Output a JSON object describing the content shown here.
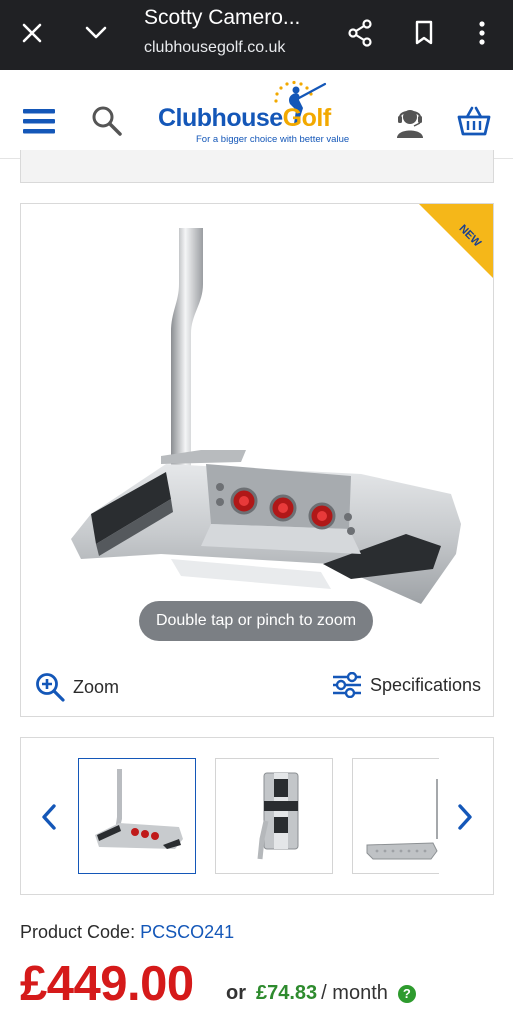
{
  "browser": {
    "title": "Scotty Camero...",
    "url": "clubhousegolf.co.uk",
    "icons": [
      "close-icon",
      "chevron-down-icon",
      "share-icon",
      "bookmark-icon",
      "more-vert-icon"
    ]
  },
  "site_header": {
    "logo_main": "Clubhouse",
    "logo_accent": "Golf",
    "tagline": "For a bigger choice with better value",
    "icons": [
      "menu-icon",
      "search-icon",
      "support-agent-icon",
      "basket-icon"
    ]
  },
  "product_gallery": {
    "badge": "NEW",
    "zoom_hint": "Double tap or pinch to zoom",
    "zoom_label": "Zoom",
    "specifications_label": "Specifications"
  },
  "product": {
    "code_label": "Product Code:",
    "code_value": "PCSCO241",
    "price": "£449.00",
    "finance_or": "or",
    "finance_amount": "£74.83",
    "finance_period": "/ month",
    "finance_help": "?"
  },
  "colors": {
    "brand_blue": "#1457b8",
    "brand_yellow": "#f2a900",
    "price_red": "#d51a1a",
    "finance_green": "#2e8b2e",
    "browser_bar": "#202124"
  }
}
